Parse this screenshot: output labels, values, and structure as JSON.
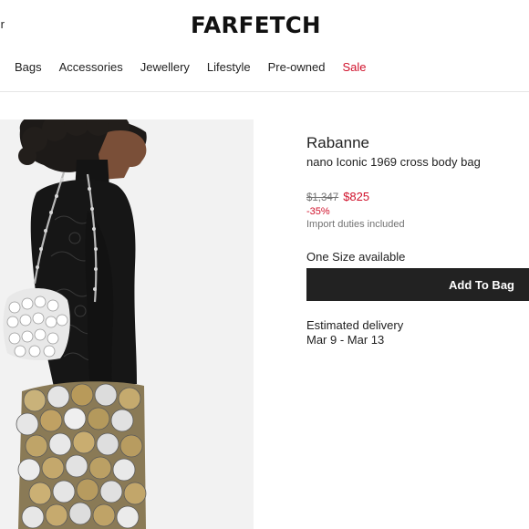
{
  "header": {
    "cut_text": "ır",
    "logo": "FARFETCH",
    "nav": [
      "Bags",
      "Accessories",
      "Jewellery",
      "Lifestyle",
      "Pre-owned",
      "Sale"
    ]
  },
  "product": {
    "brand": "Rabanne",
    "name": "nano Iconic 1969 cross body bag",
    "original_price": "$1,347",
    "sale_price": "$825",
    "discount": "-35%",
    "duties_note": "Import duties included",
    "size_availability": "One Size available",
    "add_to_bag_label": "Add To Bag",
    "delivery_label": "Estimated delivery",
    "delivery_dates": "Mar 9 - Mar 13"
  },
  "colors": {
    "sale_red": "#d0112b",
    "button_dark": "#222222",
    "muted_grey": "#727272"
  },
  "icons": {
    "product_image": "model-photo"
  }
}
